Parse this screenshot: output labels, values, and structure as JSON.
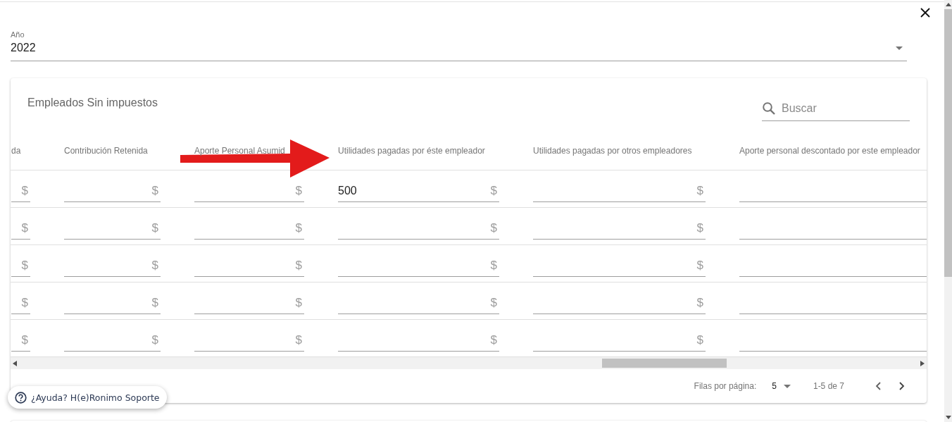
{
  "dialog": {
    "year_select": {
      "label": "Año",
      "value": "2022"
    },
    "card": {
      "title": "Empleados Sin impuestos",
      "search": {
        "placeholder": "Buscar"
      },
      "table": {
        "columns": [
          "da",
          "Contribución Retenida",
          "Aporte Personal Asumid",
          "Utilidades pagadas por éste empleador",
          "Utilidades pagadas por otros empleadores",
          "Aporte personal descontado por este empleador"
        ],
        "rows": [
          {
            "cells": [
              {
                "suffix": "$"
              },
              {
                "suffix": "$"
              },
              {
                "suffix": "$"
              },
              {
                "value": "500",
                "suffix": "$"
              },
              {
                "suffix": "$"
              }
            ]
          },
          {
            "cells": [
              {
                "suffix": "$"
              },
              {
                "suffix": "$"
              },
              {
                "suffix": "$"
              },
              {
                "suffix": "$"
              },
              {
                "suffix": "$"
              }
            ]
          },
          {
            "cells": [
              {
                "suffix": "$"
              },
              {
                "suffix": "$"
              },
              {
                "suffix": "$"
              },
              {
                "suffix": "$"
              },
              {
                "suffix": "$"
              }
            ]
          },
          {
            "cells": [
              {
                "suffix": "$"
              },
              {
                "suffix": "$"
              },
              {
                "suffix": "$"
              },
              {
                "suffix": "$"
              },
              {
                "suffix": "$"
              }
            ]
          },
          {
            "cells": [
              {
                "suffix": "$"
              },
              {
                "suffix": "$"
              },
              {
                "suffix": "$"
              },
              {
                "suffix": "$"
              },
              {
                "suffix": "$"
              }
            ]
          }
        ]
      },
      "pagination": {
        "rows_per_page_label": "Filas por página:",
        "rows_per_page": "5",
        "range": "1-5 de 7"
      }
    }
  },
  "help_button": {
    "label": "¿Ayuda? H(e)Ronimo Soporte"
  }
}
